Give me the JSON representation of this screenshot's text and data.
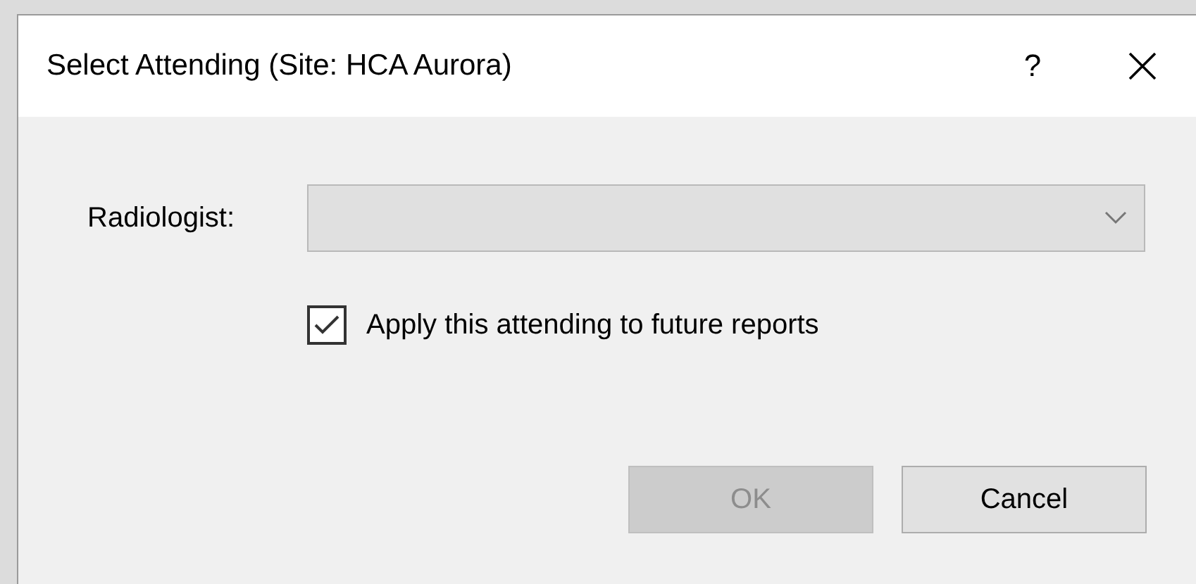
{
  "window": {
    "title": "Select Attending (Site: HCA Aurora)",
    "help": "?"
  },
  "radiologist": {
    "label": "Radiologist:",
    "disabled": true
  },
  "apply_future": {
    "label": "Apply this attending to future reports",
    "checked": true
  },
  "buttons": [
    {
      "label": "OK",
      "disabled": true
    },
    {
      "label": "Cancel",
      "disabled": false
    }
  ]
}
